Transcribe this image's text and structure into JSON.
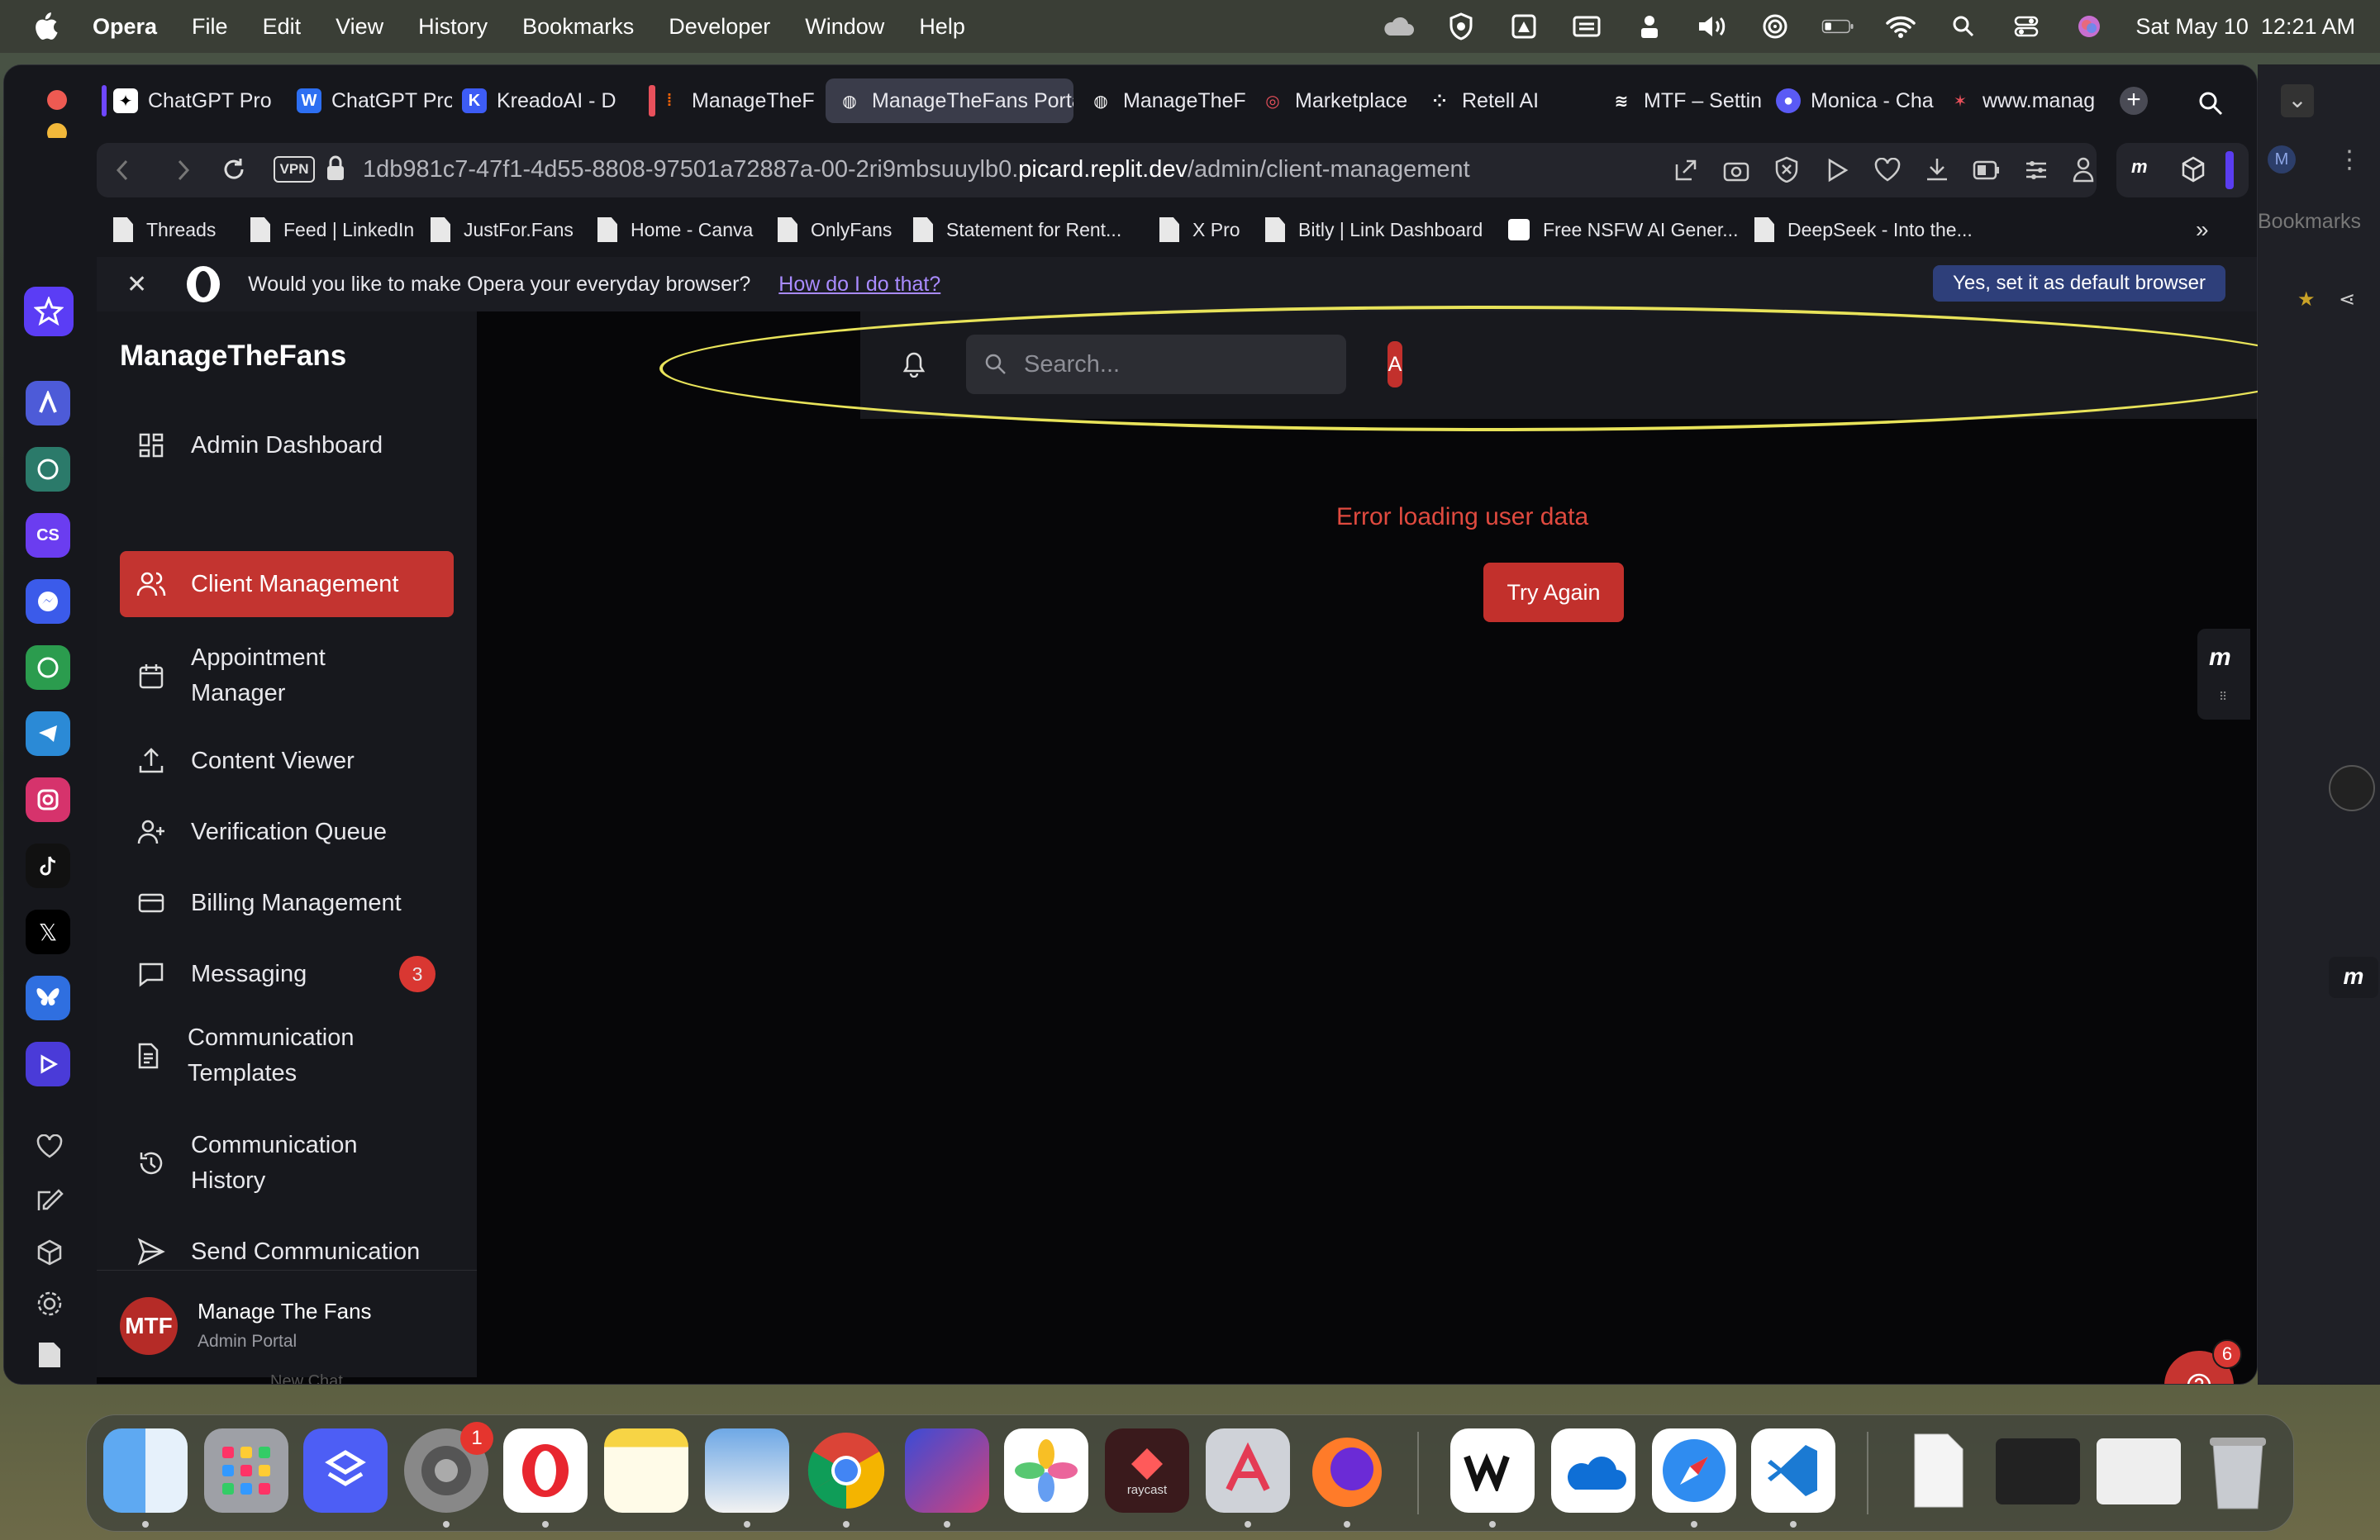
{
  "menubar": {
    "app": "Opera",
    "items": [
      "File",
      "Edit",
      "View",
      "History",
      "Bookmarks",
      "Developer",
      "Window",
      "Help"
    ],
    "datetime": "Sat May 10  12:21 AM"
  },
  "tabs": [
    {
      "label": "ChatGPT Pro",
      "icon": "chatgpt-icon"
    },
    {
      "label": "ChatGPT Pro",
      "icon": "w-icon"
    },
    {
      "label": "KreadoAI - D",
      "icon": "kreado-icon"
    },
    {
      "label": "ManageTheF",
      "icon": "replit-icon"
    },
    {
      "label": "ManageTheFans Portal",
      "icon": "globe-icon",
      "active": true
    },
    {
      "label": "ManageTheF",
      "icon": "globe-icon"
    },
    {
      "label": "Marketplace",
      "icon": "marketplace-icon"
    },
    {
      "label": "Retell AI",
      "icon": "retell-icon"
    },
    {
      "label": "MTF – Settin",
      "icon": "mtf-icon"
    },
    {
      "label": "Monica - Cha",
      "icon": "monica-icon"
    },
    {
      "label": "www.manag",
      "icon": "star-icon"
    }
  ],
  "address": {
    "vpn": "VPN",
    "host": "1db981c7-47f1-4d55-8808-97501a72887a-00-2ri9mbsuuylb0.",
    "domain": "picard.replit.dev",
    "path": "/admin/client-management"
  },
  "bookmarks": [
    "Threads",
    "Feed | LinkedIn",
    "JustFor.Fans",
    "Home - Canva",
    "OnlyFans",
    "Statement for Rent...",
    "X Pro",
    "Bitly | Link Dashboard",
    "Free NSFW AI Gener...",
    "DeepSeek - Into the..."
  ],
  "notice": {
    "text": "Would you like to make Opera your everyday browser?",
    "link": "How do I do that?",
    "button": "Yes, set it as default browser"
  },
  "app": {
    "brand": "ManageTheFans",
    "nav": [
      {
        "label": "Admin Dashboard",
        "icon": "dashboard-icon"
      },
      {
        "label": "Client Management",
        "icon": "users-icon",
        "active": true
      },
      {
        "label": "Appointment\nManager",
        "icon": "calendar-icon"
      },
      {
        "label": "Content Viewer",
        "icon": "upload-icon"
      },
      {
        "label": "Verification Queue",
        "icon": "user-plus-icon"
      },
      {
        "label": "Billing Management",
        "icon": "credit-card-icon"
      },
      {
        "label": "Messaging",
        "icon": "message-icon",
        "badge": "3"
      },
      {
        "label": "Communication\nTemplates",
        "icon": "document-icon"
      },
      {
        "label": "Communication\nHistory",
        "icon": "history-icon"
      },
      {
        "label": "Send Communication",
        "icon": "send-icon"
      }
    ],
    "user": {
      "initials": "MTF",
      "name": "Manage The Fans",
      "role": "Admin Portal"
    },
    "search_placeholder": "Search...",
    "avatar_letter": "A",
    "error": "Error loading user data",
    "retry": "Try Again",
    "help_count": "6",
    "peek_text": "New Chat"
  },
  "right_panel": {
    "avatar": "M",
    "label": "Bookmarks"
  },
  "dock": {
    "settings_badge": "1",
    "raycast_label": "raycast"
  }
}
